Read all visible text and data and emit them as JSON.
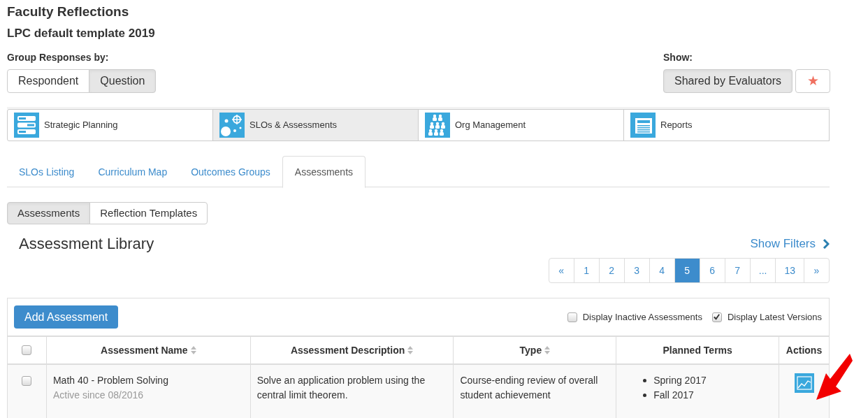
{
  "title": "Faculty Reflections",
  "subtitle": "LPC default template 2019",
  "group_by": {
    "label": "Group Responses by:",
    "options": [
      {
        "label": "Respondent",
        "selected": false
      },
      {
        "label": "Question",
        "selected": true
      }
    ]
  },
  "show": {
    "label": "Show:",
    "options": [
      {
        "label": "Shared by Evaluators",
        "selected": true
      },
      {
        "label": "★",
        "selected": false
      }
    ]
  },
  "modules": [
    {
      "label": "Strategic Planning",
      "kind": "planning",
      "selected": false
    },
    {
      "label": "SLOs & Assessments",
      "kind": "target",
      "selected": true
    },
    {
      "label": "Org Management",
      "kind": "people",
      "selected": false
    },
    {
      "label": "Reports",
      "kind": "report",
      "selected": false
    }
  ],
  "tabs": [
    {
      "label": "SLOs Listing",
      "selected": false
    },
    {
      "label": "Curriculum Map",
      "selected": false
    },
    {
      "label": "Outcomes Groups",
      "selected": false
    },
    {
      "label": "Assessments",
      "selected": true
    }
  ],
  "subtabs": [
    {
      "label": "Assessments",
      "selected": true
    },
    {
      "label": "Reflection Templates",
      "selected": false
    }
  ],
  "library_title": "Assessment Library",
  "show_filters": "Show Filters",
  "pagination": [
    {
      "label": "«",
      "selected": false
    },
    {
      "label": "1",
      "selected": false
    },
    {
      "label": "2",
      "selected": false
    },
    {
      "label": "3",
      "selected": false
    },
    {
      "label": "4",
      "selected": false
    },
    {
      "label": "5",
      "selected": true
    },
    {
      "label": "6",
      "selected": false
    },
    {
      "label": "7",
      "selected": false
    },
    {
      "label": "...",
      "selected": false
    },
    {
      "label": "13",
      "selected": false
    },
    {
      "label": "»",
      "selected": false
    }
  ],
  "add_button": "Add Assessment",
  "options": [
    {
      "label": "Display Inactive Assessments",
      "checked": false
    },
    {
      "label": "Display Latest Versions",
      "checked": true
    }
  ],
  "table": {
    "header_checked": false,
    "columns": [
      {
        "label": "Assessment Name",
        "sortable": true
      },
      {
        "label": "Assessment Description",
        "sortable": true
      },
      {
        "label": "Type",
        "sortable": true
      },
      {
        "label": "Planned Terms",
        "sortable": false
      },
      {
        "label": "Actions",
        "sortable": false
      }
    ],
    "rows": [
      {
        "checked": false,
        "name": "Math 40 - Problem Solving",
        "status": "Active since 08/2016",
        "description": "Solve an application problem using the central limit theorem.",
        "type": "Course-ending review of overall student achievement",
        "terms": [
          "Spring 2017",
          "Fall 2017"
        ]
      }
    ]
  }
}
